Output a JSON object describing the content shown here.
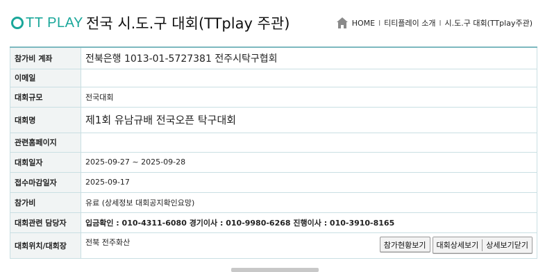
{
  "header": {
    "logo_text": "TT PLAY",
    "page_title": "전국 시.도.구 대회(TTplay 주관)",
    "breadcrumb": {
      "home": "HOME",
      "intro": "티티플레이 소개",
      "current": "시.도.구 대회(TTplay주관)",
      "separator": "l"
    }
  },
  "rows": {
    "account": {
      "label": "참가비 계좌",
      "value": "전북은행 1013-01-5727381 전주시탁구협회"
    },
    "email": {
      "label": "이메일",
      "value": ""
    },
    "scale": {
      "label": "대회규모",
      "value": "전국대회"
    },
    "name": {
      "label": "대회명",
      "value": "제1회 유남규배 전국오픈 탁구대회"
    },
    "homepage": {
      "label": "관련홈페이지",
      "value": ""
    },
    "dates": {
      "label": "대회일자",
      "value": "2025-09-27 ~ 2025-09-28"
    },
    "deadline": {
      "label": "접수마감일자",
      "value": "2025-09-17"
    },
    "fee": {
      "label": "참가비",
      "value": "유료 (상세정보 대회공지확인요망)"
    },
    "contact": {
      "label": "대회관련 담당자",
      "value": "입금확인 : 010-4311-6080 경기이사 : 010-9980-6268 진행이사 : 010-3910-8165"
    },
    "location": {
      "label": "대회위치/대회장",
      "value": "전북 전주화산"
    }
  },
  "buttons": {
    "participants": "참가현황보기",
    "details": "대회상세보기",
    "close": "상세보기닫기"
  },
  "colors": {
    "brand": "#1aa79a",
    "link_blue": "#1d3aa6",
    "table_border": "#7cb8bf"
  },
  "icons": {
    "home": "home-icon"
  }
}
